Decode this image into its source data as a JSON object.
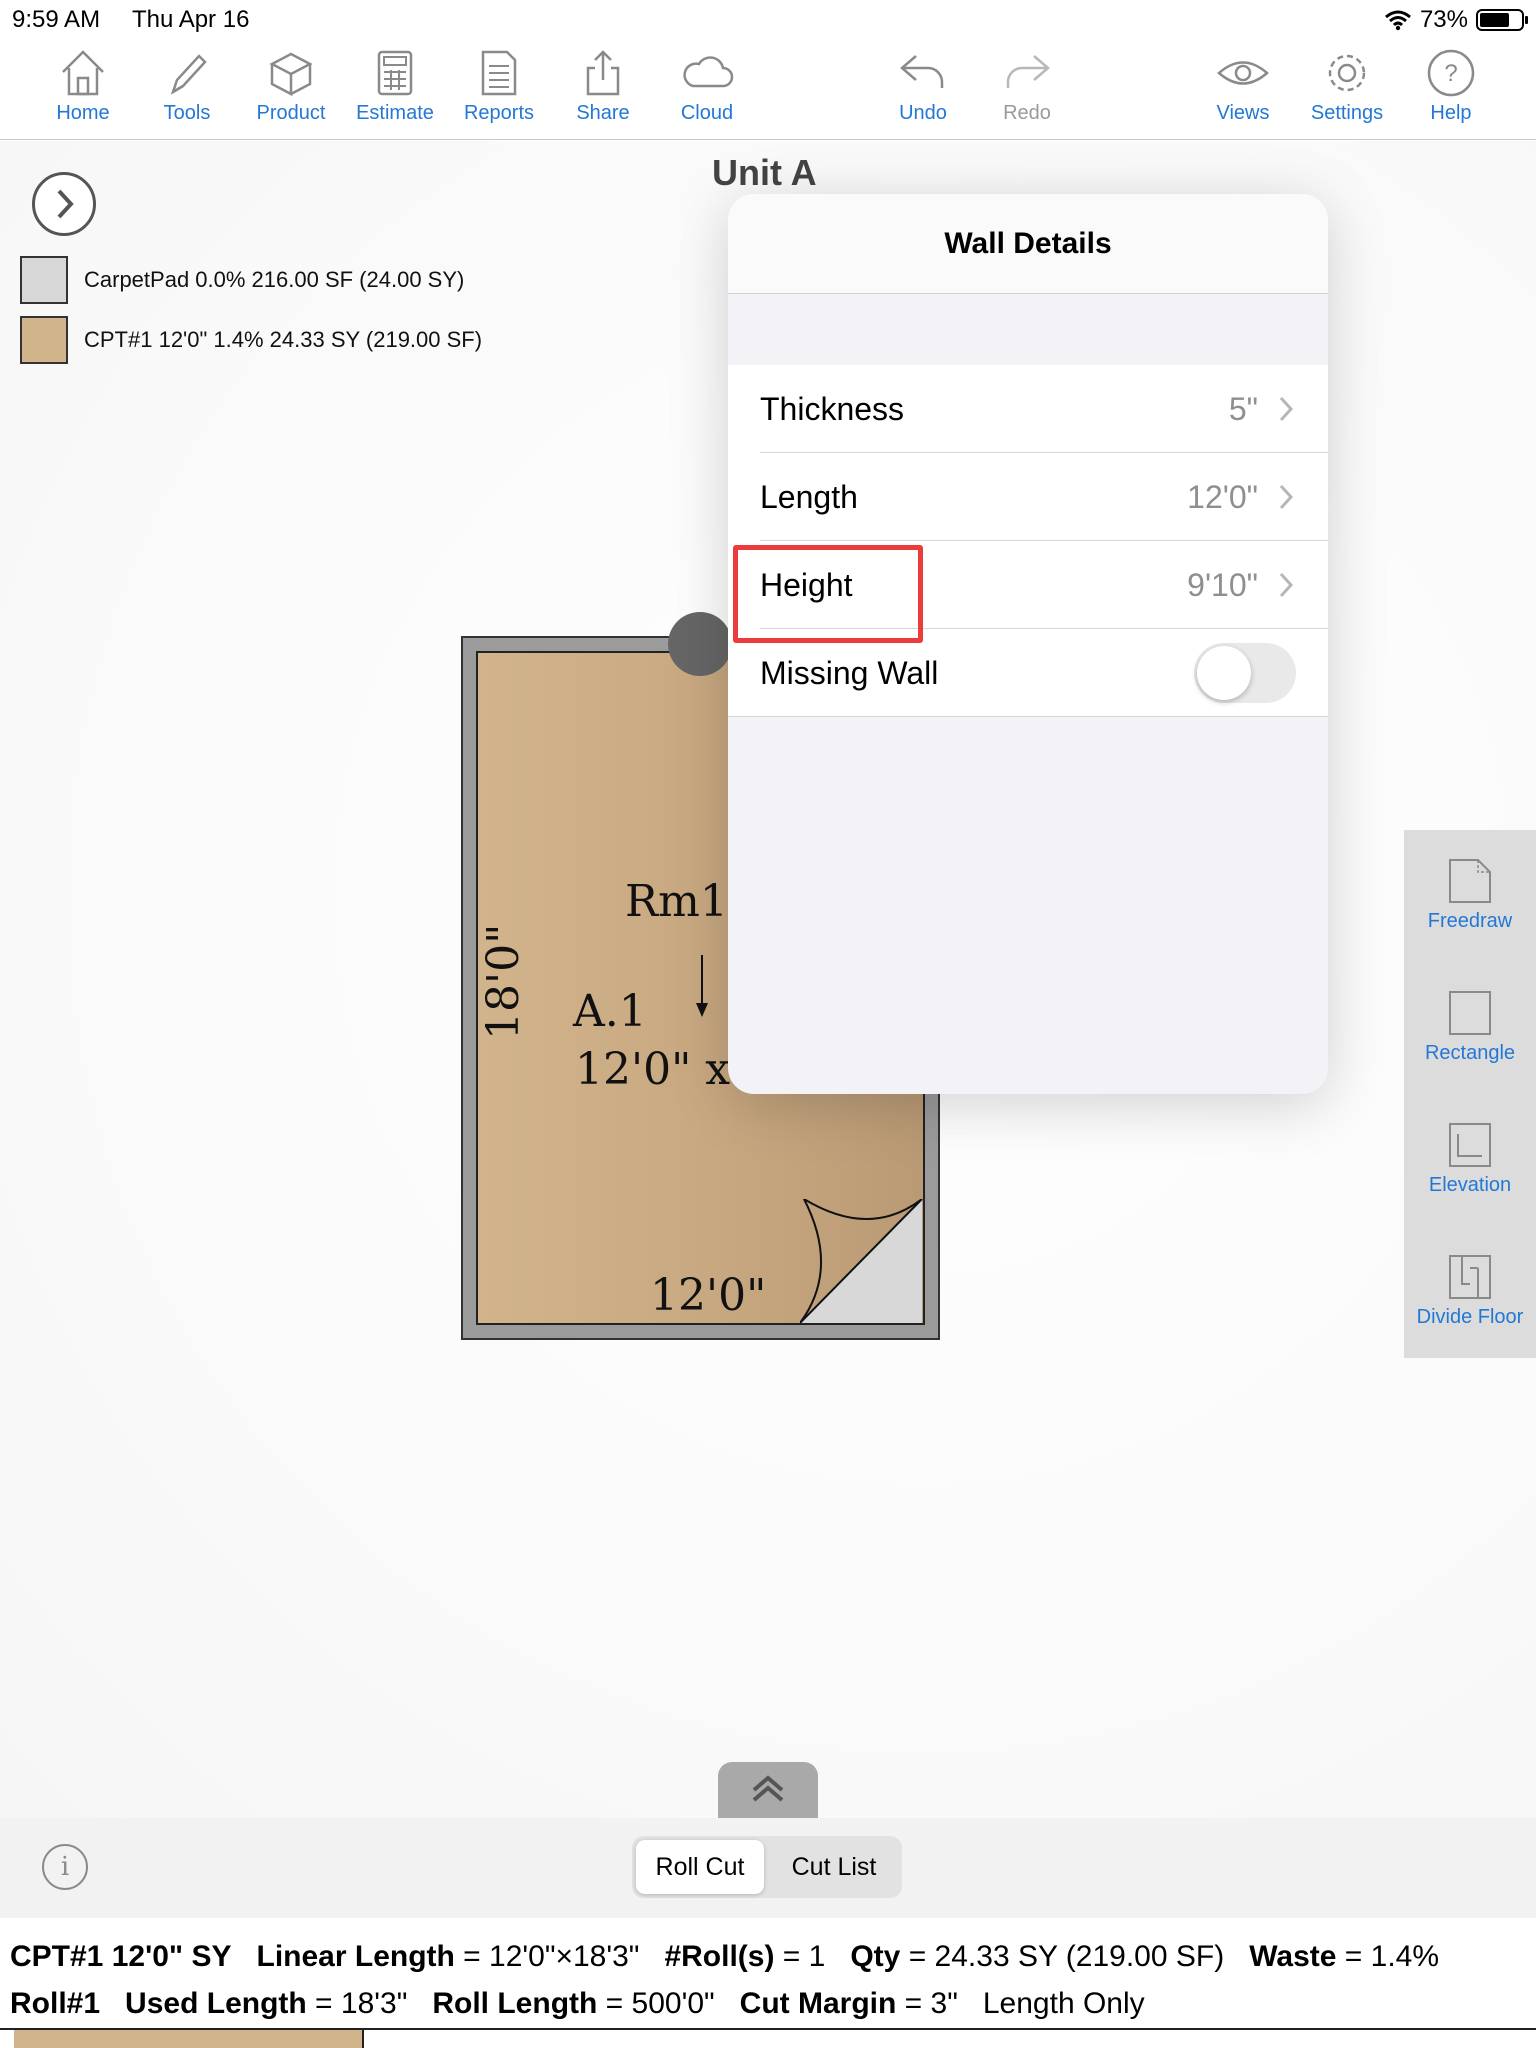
{
  "status": {
    "time": "9:59 AM",
    "date": "Thu Apr 16",
    "battery": "73%",
    "battery_level": 0.73
  },
  "toolbar": {
    "home": "Home",
    "tools": "Tools",
    "product": "Product",
    "estimate": "Estimate",
    "reports": "Reports",
    "share": "Share",
    "cloud": "Cloud",
    "undo": "Undo",
    "redo": "Redo",
    "views": "Views",
    "settings": "Settings",
    "help": "Help"
  },
  "legend": [
    {
      "label": "CarpetPad  0.0% 216.00 SF (24.00 SY)",
      "color": "#d8d8d8"
    },
    {
      "label": "CPT#1 12'0\" 1.4% 24.33 SY (219.00 SF)",
      "color": "#d2b48c"
    }
  ],
  "unit_title": "Unit A",
  "room": {
    "name": "Rm1",
    "area_label": "A.1",
    "dims_label": "12'0\" x",
    "side_length": "18'0\"",
    "bottom_length": "12'0\""
  },
  "wall_details": {
    "title": "Wall Details",
    "rows": [
      {
        "label": "Thickness",
        "value": "5\""
      },
      {
        "label": "Length",
        "value": "12'0\""
      },
      {
        "label": "Height",
        "value": "9'10\""
      }
    ],
    "missing_wall": {
      "label": "Missing Wall",
      "on": false
    }
  },
  "side_tools": {
    "freedraw": "Freedraw",
    "rectangle": "Rectangle",
    "elevation": "Elevation",
    "divide_floor": "Divide Floor"
  },
  "tabs": {
    "roll_cut": "Roll Cut",
    "cut_list": "Cut List",
    "active": "Roll Cut"
  },
  "summary": {
    "line1": {
      "product": "CPT#1 12'0\" SY",
      "linear_label": "Linear Length",
      "linear_value": " = 12'0\"×18'3\"",
      "rolls_label": "#Roll(s)",
      "rolls_value": " = 1",
      "qty_label": "Qty",
      "qty_value": " = 24.33 SY (219.00 SF)",
      "waste_label": "Waste",
      "waste_value": " = 1.4%"
    },
    "line2": {
      "roll": "Roll#1",
      "used_label": "Used Length",
      "used_value": " = 18'3\"",
      "roll_length_label": "Roll Length",
      "roll_length_value": " = 500'0\"",
      "cut_margin_label": "Cut Margin",
      "cut_margin_value": " = 3\"",
      "mode": "Length Only"
    }
  },
  "colors": {
    "accent": "#2378d6",
    "highlight": "#ec3b3b",
    "carpet": "#d2b48c"
  }
}
